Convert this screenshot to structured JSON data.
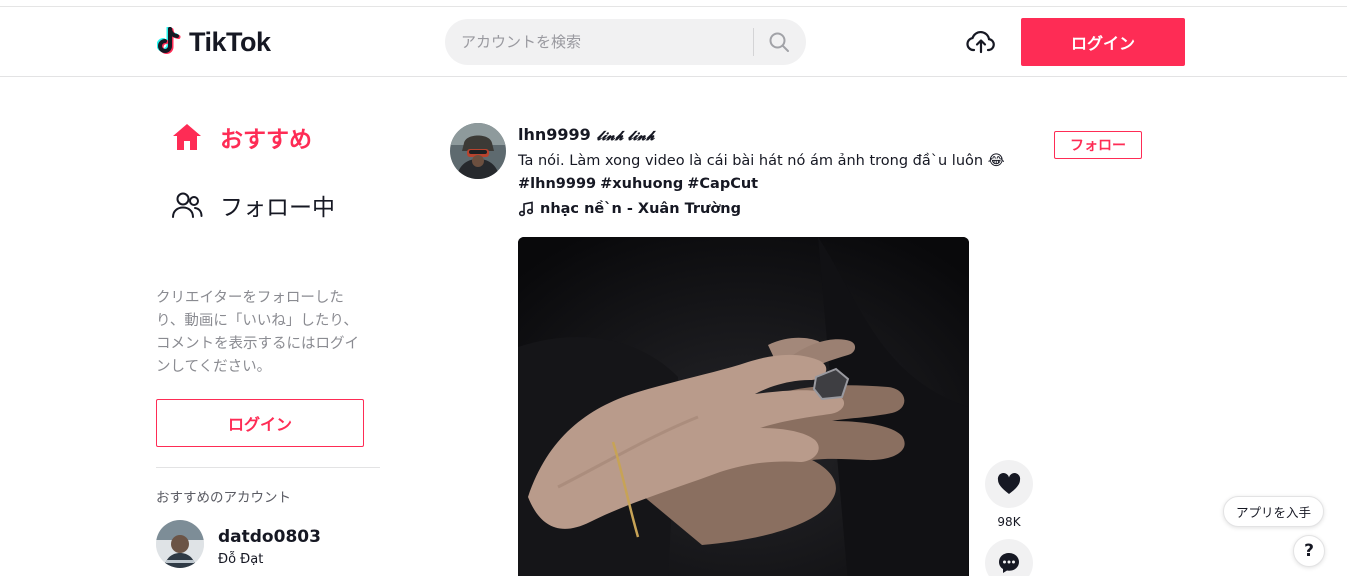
{
  "header": {
    "logo_text": "TikTok",
    "search_placeholder": "アカウントを検索",
    "upload_icon": "cloud-upload-icon",
    "login_label": "ログイン"
  },
  "sidebar": {
    "nav": [
      {
        "label": "おすすめ",
        "icon": "home-icon",
        "active": true
      },
      {
        "label": "フォロー中",
        "icon": "people-icon",
        "active": false
      }
    ],
    "login_hint": "クリエイターをフォローしたり、動画に「いいね」したり、コメントを表示するにはログインしてください。",
    "login_label": "ログイン",
    "suggested_title": "おすすめのアカウント",
    "accounts": [
      {
        "username": "datdo0803",
        "nickname": "Đỗ Đạt"
      }
    ]
  },
  "post": {
    "username": "lhn9999",
    "nickname": "𝓵𝓲𝓷𝓱 𝓵𝓲𝓷𝓱",
    "follow_label": "フォロー",
    "description": "Ta nói. Làm xong video là cái bài hát nó ám ảnh trong đầ`u luôn 😂",
    "hashtags": [
      "#lhn9999",
      "#xuhuong",
      "#CapCut"
    ],
    "music": "nhạc nề`n - Xuân Trường",
    "actions": {
      "like_count": "98K"
    }
  },
  "floating": {
    "get_app_label": "アプリを入手",
    "help_label": "?"
  },
  "colors": {
    "brand": "#fe2c55",
    "text": "#161823",
    "muted": "#8a8b91"
  }
}
